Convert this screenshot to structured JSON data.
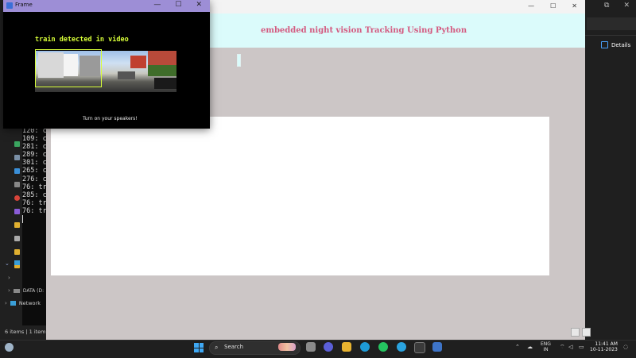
{
  "frame": {
    "title": "Frame",
    "detection_text": "train detected in video",
    "speaker_text": "Turn on your speakers!"
  },
  "app": {
    "title": "embedded night vision  Tracking Using Python"
  },
  "explorer": {
    "details_label": "Details",
    "console_lines": [
      "120: c",
      "109: c",
      "281: c",
      "289: c",
      "301: c",
      "265: c",
      "276: c",
      "76: tr",
      "285: c",
      "76: tr",
      "76: tr"
    ],
    "nav_items": {
      "data_drive": "DATA (D:",
      "network": "Network"
    },
    "status": {
      "items": "6 items",
      "selected": "1 item"
    }
  },
  "taskbar": {
    "search_label": "Search",
    "lang_line1": "ENG",
    "lang_line2": "IN",
    "time": "11:41 AM",
    "date": "10-11-2023"
  },
  "colors": {
    "app_header_bg": "#dbfbfb",
    "app_title": "#d45a80",
    "detection_text": "#d8ff38",
    "frame_titlebar": "#9d8ed6",
    "app_body_bg": "#ccc6c6"
  }
}
